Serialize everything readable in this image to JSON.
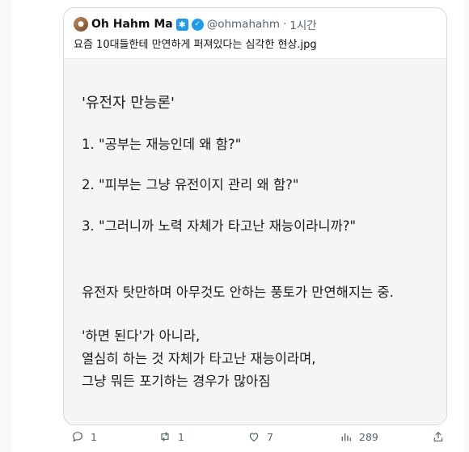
{
  "quoted_tweet": {
    "author_name": "Oh Hahm Ma",
    "handle": "@ohmahahm",
    "time": "1시간",
    "text": "요즘 10대들한테 만연하게 퍼져있다는 심각한 현상.jpg"
  },
  "image_text": {
    "title": "'유전자 만능론'",
    "item1": "1. \"공부는 재능인데 왜 함?\"",
    "item2": "2. \"피부는 그냥 유전이지 관리 왜 함?\"",
    "item3": "3. \"그러니까 노력 자체가 타고난 재능이라니까?\"",
    "para1": "유전자 탓만하며 아무것도 안하는 풍토가 만연해지는 중.",
    "para2_line1": "'하면 된다'가 아니라,",
    "para2_line2": "열심히 하는 것 자체가 타고난 재능이라며,",
    "para2_line3": "그냥 뭐든 포기하는 경우가 많아짐"
  },
  "actions": {
    "reply_count": "1",
    "retweet_count": "1",
    "like_count": "7",
    "views_count": "289"
  },
  "icons": [
    "reply-icon",
    "retweet-icon",
    "like-icon",
    "views-icon",
    "share-icon",
    "verified-icon"
  ],
  "colors": {
    "accent": "#1d9bf0",
    "muted": "#536471"
  }
}
